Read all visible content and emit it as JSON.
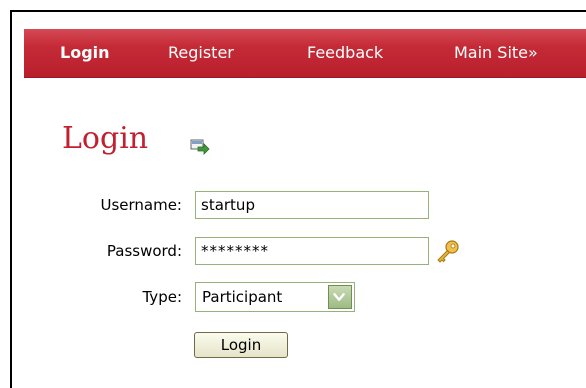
{
  "nav": {
    "items": [
      {
        "label": "Login",
        "active": true
      },
      {
        "label": "Register",
        "active": false
      },
      {
        "label": "Feedback",
        "active": false
      },
      {
        "label": "Main Site»",
        "active": false
      }
    ]
  },
  "page": {
    "title": "Login",
    "title_icon": "login-arrow-icon"
  },
  "form": {
    "username": {
      "label": "Username:",
      "value": "startup"
    },
    "password": {
      "label": "Password:",
      "value": "********",
      "icon": "key-icon"
    },
    "type": {
      "label": "Type:",
      "selected": "Participant"
    },
    "submit_label": "Login"
  },
  "colors": {
    "nav_background": "#c62b38",
    "title": "#c22031",
    "input_border": "#94b377"
  }
}
